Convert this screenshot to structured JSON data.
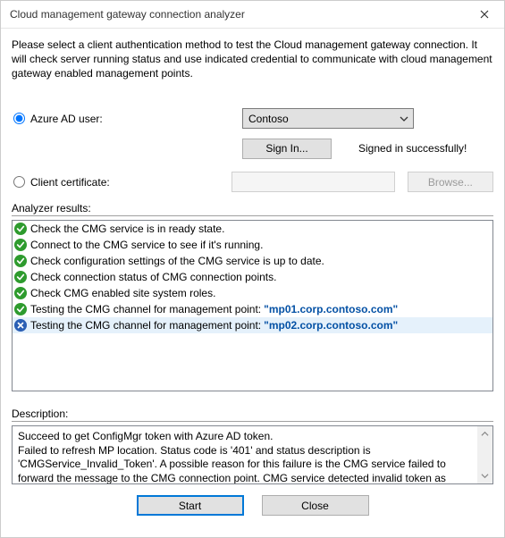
{
  "window": {
    "title": "Cloud management gateway connection analyzer",
    "intro": "Please select a client authentication method to test the Cloud management gateway connection. It will check server running status and use indicated credential to communicate with cloud management gateway enabled management points."
  },
  "auth": {
    "option_azure_label": "Azure AD user:",
    "azure_tenant_selected": "Contoso",
    "sign_in_label": "Sign In...",
    "signed_in_status": "Signed in successfully!",
    "option_cert_label": "Client certificate:",
    "cert_value": "",
    "browse_label": "Browse..."
  },
  "results": {
    "section_label": "Analyzer results:",
    "items": [
      {
        "status": "ok",
        "text": "Check the CMG service is in ready state."
      },
      {
        "status": "ok",
        "text": "Connect to the CMG service to see if it's running."
      },
      {
        "status": "ok",
        "text": "Check configuration settings of the CMG service is up to date."
      },
      {
        "status": "ok",
        "text": "Check connection status of CMG connection points."
      },
      {
        "status": "ok",
        "text": "Check CMG enabled site system roles."
      },
      {
        "status": "ok",
        "text": "Testing the CMG channel for management point:",
        "host": "\"mp01.corp.contoso.com\""
      },
      {
        "status": "err",
        "text": "Testing the CMG channel for management point:",
        "host": "\"mp02.corp.contoso.com\"",
        "selected": true
      }
    ]
  },
  "description": {
    "section_label": "Description:",
    "text": "Succeed to get ConfigMgr token with Azure AD token.\nFailed to refresh MP location. Status code is '401' and status description is 'CMGService_Invalid_Token'. A possible reason for this failure is the CMG service failed to forward the message to the CMG connection point. CMG service detected invalid token as client credential."
  },
  "buttons": {
    "start": "Start",
    "close": "Close"
  }
}
